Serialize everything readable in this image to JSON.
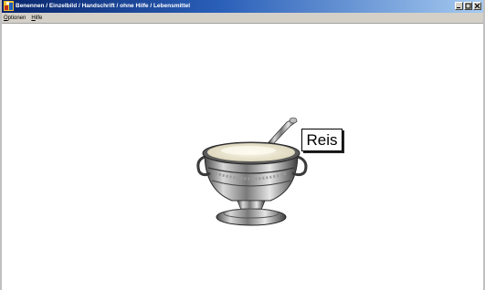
{
  "window": {
    "title": "Benennen / Einzelbild / Handschrift / ohne Hilfe / Lebensmittel"
  },
  "menu": {
    "items": [
      {
        "first": "O",
        "rest": "ptionen"
      },
      {
        "first": "H",
        "rest": "ilfe"
      }
    ]
  },
  "exercise": {
    "picture_icon": "rice-bowl-icon",
    "word": "Reis"
  },
  "colors": {
    "titlebar_start": "#08246b",
    "titlebar_end": "#a6caf0",
    "menubar": "#d4d0c8",
    "content": "#ffffff"
  }
}
